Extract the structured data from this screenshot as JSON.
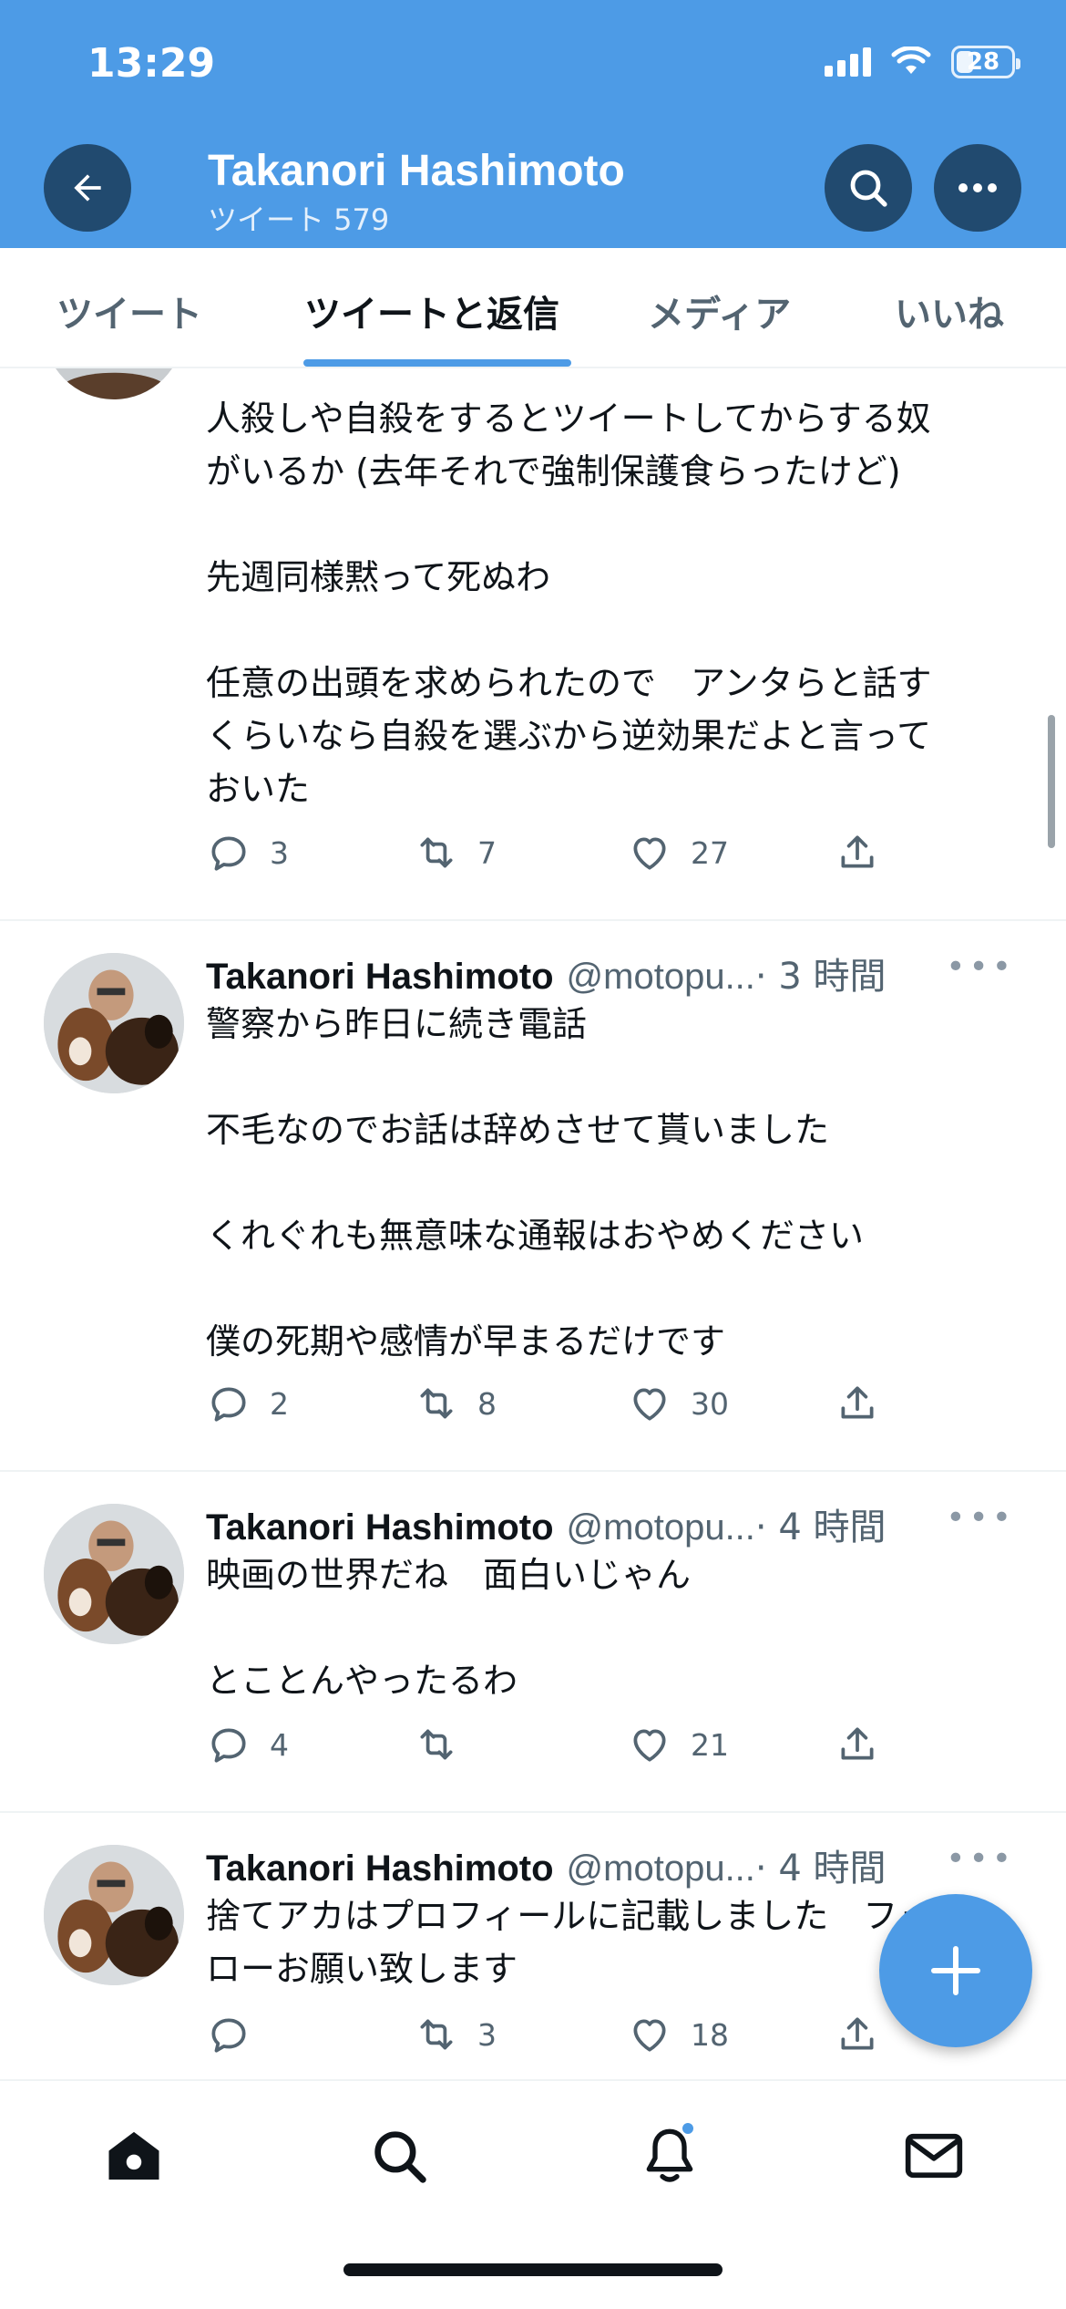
{
  "status_bar": {
    "time": "13:29",
    "battery": "28",
    "battery_level": 0.28
  },
  "header": {
    "name": "Takanori Hashimoto",
    "tweet_count": "ツイート 579",
    "back_icon": "back-arrow-icon",
    "search_icon": "search-icon",
    "more_icon": "more-icon"
  },
  "tabs": [
    {
      "label": "ツイート",
      "active": false
    },
    {
      "label": "ツイートと返信",
      "active": true
    },
    {
      "label": "メディア",
      "active": false
    },
    {
      "label": "いいね",
      "active": false
    }
  ],
  "tweets": [
    {
      "text": "人殺しや自殺をするとツイートしてからする奴\nがいるか (去年それで強制保護食らったけど)\n\n先週同様黙って死ぬわ\n\n任意の出頭を求められたので　アンタらと話す\nくらいなら自殺を選ぶから逆効果だよと言って\nおいた",
      "replies": "3",
      "retweets": "7",
      "likes": "27"
    },
    {
      "name": "Takanori Hashimoto",
      "handle": "@motopu...",
      "time": "· 3 時間",
      "text": "警察から昨日に続き電話\n\n不毛なのでお話は辞めさせて貰いました\n\nくれぐれも無意味な通報はおやめください\n\n僕の死期や感情が早まるだけです",
      "replies": "2",
      "retweets": "8",
      "likes": "30"
    },
    {
      "name": "Takanori Hashimoto",
      "handle": "@motopu...",
      "time": "· 4 時間",
      "text": "映画の世界だね　面白いじゃん\n\nとことんやったるわ",
      "replies": "4",
      "retweets": "",
      "likes": "21"
    },
    {
      "name": "Takanori Hashimoto",
      "handle": "@motopu...",
      "time": "· 4 時間",
      "text": "捨てアカはプロフィールに記載しました　フォ\nローお願い致します",
      "replies": "",
      "retweets": "3",
      "likes": "18"
    }
  ],
  "fab": {
    "icon": "compose-plus-icon"
  },
  "bottom_nav": [
    {
      "icon": "home-icon"
    },
    {
      "icon": "search-icon"
    },
    {
      "icon": "bell-icon",
      "has_badge": true
    },
    {
      "icon": "mail-icon"
    }
  ],
  "colors": {
    "header_bg": "#4d9be6",
    "accent": "#4d9be6",
    "secondary_text": "#536471"
  }
}
